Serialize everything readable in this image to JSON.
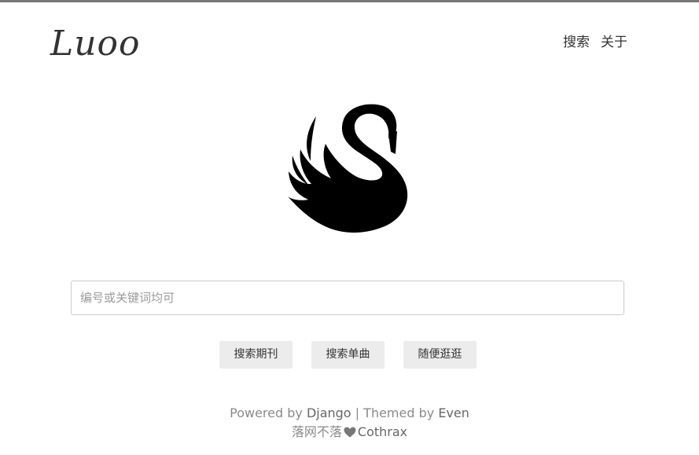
{
  "header": {
    "logo_text": "Luoo",
    "nav": [
      {
        "label": "搜索"
      },
      {
        "label": "关于"
      }
    ]
  },
  "hero": {
    "logo_icon": "swan-icon",
    "logo_color": "#000000"
  },
  "search": {
    "placeholder": "编号或关键词均可",
    "value": ""
  },
  "actions": [
    {
      "label": "搜索期刊"
    },
    {
      "label": "搜索单曲"
    },
    {
      "label": "随便逛逛"
    }
  ],
  "footer": {
    "powered_prefix": "Powered by",
    "powered_link": "Django",
    "separator": "|",
    "themed_prefix": "Themed by",
    "themed_link": "Even",
    "site_name": "落网不落",
    "heart_icon": "heart-icon",
    "author": "Cothrax"
  },
  "colors": {
    "top_bar": "#777777",
    "text": "#333333",
    "muted": "#8a8a8a",
    "button_bg": "#ececec"
  }
}
